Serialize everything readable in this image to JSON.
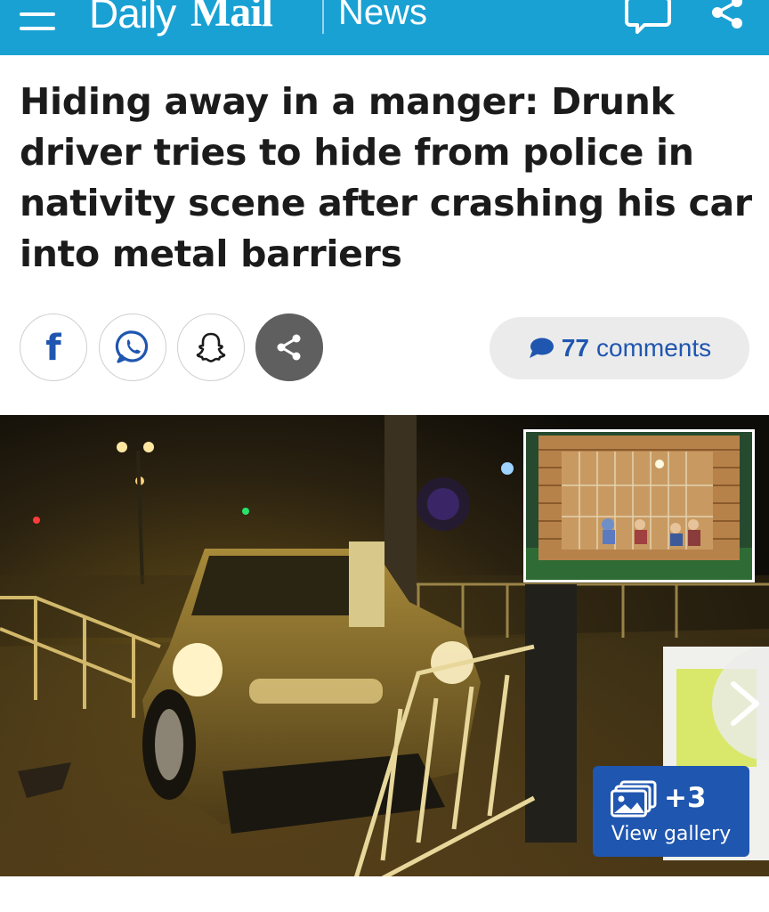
{
  "header": {
    "brand_daily": "Daily",
    "brand_mail": "Mail",
    "section": "News",
    "menu_icon": "hamburger-menu-icon",
    "comment_icon": "speech-bubble-icon",
    "share_icon": "share-icon",
    "background_color": "#1aa1d4"
  },
  "article": {
    "headline": "Hiding away in a manger: Drunk driver tries to hide from police in nativity scene after crashing his car into metal barriers"
  },
  "share_bar": {
    "buttons": [
      {
        "name": "facebook",
        "icon": "facebook-icon",
        "glyph": "f"
      },
      {
        "name": "whatsapp",
        "icon": "whatsapp-icon"
      },
      {
        "name": "snapchat",
        "icon": "snapchat-icon"
      },
      {
        "name": "more-share",
        "icon": "share-icon"
      }
    ],
    "comments_count": "77",
    "comments_label": "comments",
    "link_color": "#1f56b0"
  },
  "gallery": {
    "count": "+3",
    "label": "View gallery",
    "icon": "image-stack-icon",
    "next_icon": "chevron-right-icon",
    "button_color": "#1f56b0"
  }
}
